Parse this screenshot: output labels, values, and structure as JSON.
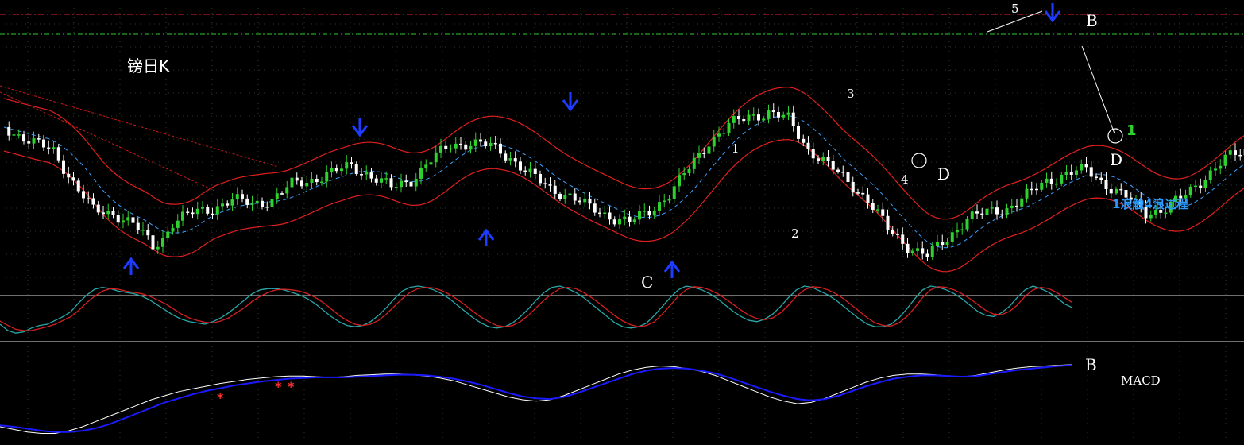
{
  "chart_data": [
    {
      "type": "candlestick",
      "title": "镑日K",
      "wave_labels": [
        "1",
        "2",
        "3",
        "4",
        "5"
      ],
      "point_labels": [
        "B",
        "C",
        "D",
        "D"
      ],
      "annotations": [
        "1",
        "1浪触4浪过程"
      ],
      "colors": {
        "up": "#2ed12e",
        "down": "#ffffff",
        "band": "#e0201e",
        "ma": "#3aa0ff",
        "trendline": "#c81818",
        "arrow": "#1e3cff",
        "top_line": "#e8202a",
        "level_line": "#2ecc2e",
        "annotation_green": "#2ed12e",
        "annotation_blue": "#2b9bff"
      }
    },
    {
      "type": "line",
      "panel": "stochastic",
      "series": [
        {
          "color": "#2aa8a8",
          "values": [
            40,
            30,
            26,
            28,
            34,
            38,
            40,
            46,
            52,
            60,
            74,
            86,
            95,
            98,
            96,
            92,
            90,
            88,
            84,
            78,
            70,
            62,
            54,
            48,
            44,
            42,
            40,
            44,
            50,
            58,
            68,
            78,
            88,
            94,
            96,
            96,
            94,
            90,
            86,
            80,
            72,
            62,
            52,
            44,
            38,
            36,
            38,
            44,
            54,
            66,
            80,
            92,
            98,
            100,
            98,
            94,
            88,
            80,
            70,
            60,
            50,
            42,
            36,
            34,
            36,
            42,
            52,
            64,
            78,
            90,
            98,
            100,
            96,
            90,
            82,
            72,
            62,
            52,
            42,
            36,
            34,
            36,
            42,
            54,
            68,
            82,
            94,
            100,
            98,
            94,
            88,
            80,
            70,
            60,
            52,
            46,
            44,
            48,
            56,
            68,
            82,
            94,
            100,
            98,
            92,
            86,
            78,
            68,
            58,
            48,
            40,
            36,
            36,
            40,
            50,
            64,
            80,
            94,
            100,
            98,
            94,
            88,
            80,
            70,
            60,
            54,
            52,
            58,
            68,
            82,
            94,
            100,
            96,
            90,
            82,
            72,
            66
          ]
        },
        {
          "color": "#d62020",
          "values": [
            45,
            38,
            32,
            30,
            30,
            33,
            36,
            40,
            46,
            52,
            62,
            74,
            84,
            92,
            96,
            95,
            92,
            90,
            88,
            84,
            78,
            72,
            64,
            56,
            50,
            46,
            43,
            42,
            45,
            50,
            58,
            66,
            76,
            84,
            90,
            94,
            95,
            94,
            92,
            88,
            82,
            74,
            64,
            54,
            46,
            40,
            38,
            40,
            46,
            56,
            68,
            80,
            90,
            96,
            98,
            97,
            93,
            87,
            79,
            70,
            60,
            51,
            44,
            38,
            36,
            38,
            44,
            54,
            66,
            78,
            88,
            96,
            98,
            96,
            90,
            82,
            73,
            63,
            53,
            45,
            39,
            36,
            38,
            44,
            56,
            70,
            84,
            94,
            99,
            98,
            94,
            88,
            80,
            71,
            62,
            54,
            49,
            47,
            50,
            58,
            70,
            84,
            94,
            99,
            98,
            94,
            88,
            80,
            70,
            60,
            50,
            42,
            38,
            37,
            42,
            52,
            66,
            82,
            94,
            99,
            98,
            94,
            88,
            80,
            71,
            62,
            56,
            55,
            60,
            70,
            84,
            94,
            98,
            96,
            90,
            82,
            74
          ]
        }
      ],
      "reference_levels": [
        80,
        20
      ]
    },
    {
      "type": "line",
      "panel": "MACD",
      "title": "MACD",
      "label": "B",
      "series": [
        {
          "color": "#ffffff",
          "values": [
            -40,
            -44,
            -48,
            -50,
            -50,
            -46,
            -40,
            -32,
            -24,
            -16,
            -8,
            0,
            6,
            12,
            16,
            20,
            24,
            27,
            30,
            32,
            34,
            35,
            35,
            34,
            33,
            34,
            36,
            37,
            38,
            38,
            37,
            35,
            32,
            28,
            22,
            16,
            10,
            4,
            0,
            -2,
            0,
            6,
            14,
            22,
            30,
            38,
            44,
            48,
            50,
            49,
            46,
            42,
            36,
            28,
            20,
            12,
            4,
            -2,
            -6,
            -4,
            2,
            10,
            18,
            26,
            32,
            36,
            38,
            38,
            37,
            35,
            34,
            36,
            40,
            44,
            47,
            49,
            50,
            51,
            52
          ]
        },
        {
          "color": "#1a1aff",
          "values": [
            -38,
            -40,
            -43,
            -46,
            -48,
            -48,
            -46,
            -42,
            -36,
            -28,
            -20,
            -12,
            -4,
            2,
            8,
            13,
            17,
            21,
            24,
            27,
            29,
            31,
            32,
            33,
            33,
            33,
            34,
            35,
            36,
            37,
            37,
            36,
            34,
            31,
            27,
            22,
            16,
            10,
            5,
            2,
            1,
            4,
            10,
            17,
            24,
            31,
            38,
            43,
            46,
            47,
            46,
            43,
            39,
            33,
            26,
            19,
            12,
            6,
            1,
            -1,
            1,
            6,
            13,
            20,
            26,
            31,
            34,
            36,
            36,
            35,
            34,
            35,
            38,
            41,
            44,
            46,
            48,
            50,
            51
          ]
        }
      ]
    }
  ]
}
